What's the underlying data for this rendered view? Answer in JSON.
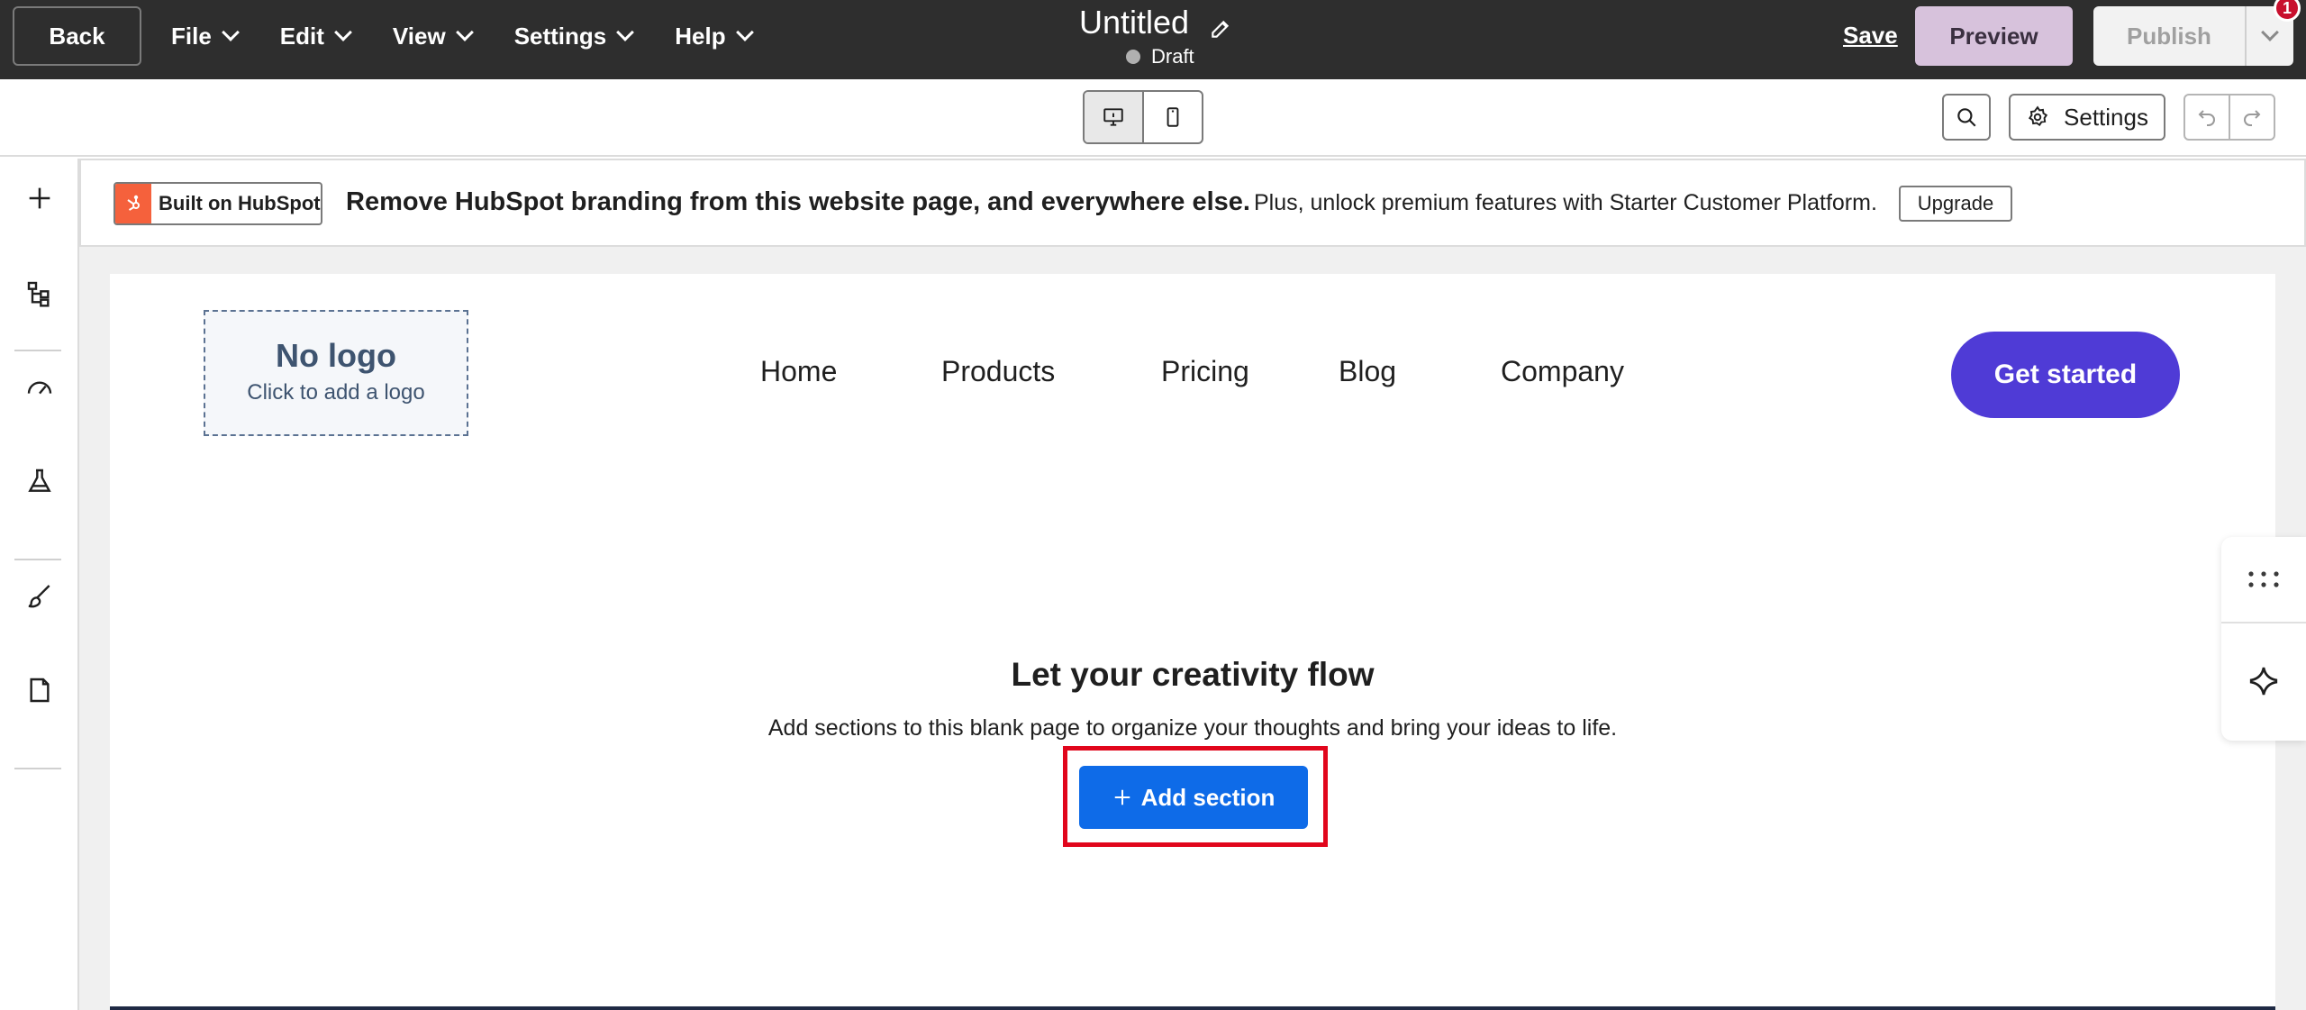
{
  "topbar": {
    "back_label": "Back",
    "menu": [
      {
        "label": "File"
      },
      {
        "label": "Edit"
      },
      {
        "label": "View"
      },
      {
        "label": "Settings"
      },
      {
        "label": "Help"
      }
    ],
    "page_title": "Untitled",
    "status": "Draft",
    "save_label": "Save",
    "preview_label": "Preview",
    "publish_label": "Publish",
    "notification_count": "1"
  },
  "toolbar": {
    "settings_label": "Settings"
  },
  "banner": {
    "badge_label": "Built on HubSpot",
    "headline": "Remove HubSpot branding from this website page, and everywhere else.",
    "text": "Plus, unlock premium features with Starter Customer Platform.",
    "upgrade_label": "Upgrade"
  },
  "page": {
    "logo_title": "No logo",
    "logo_subtitle": "Click to add a logo",
    "nav": [
      {
        "label": "Home"
      },
      {
        "label": "Products"
      },
      {
        "label": "Pricing"
      },
      {
        "label": "Blog"
      },
      {
        "label": "Company"
      }
    ],
    "cta_label": "Get started",
    "empty_title": "Let your creativity flow",
    "empty_subtitle": "Add sections to this blank page to organize your thoughts and bring your ideas to life.",
    "add_section_label": "Add section"
  },
  "colors": {
    "topbar_bg": "#2e2e2e",
    "preview_bg": "#d7c2dc",
    "cta_bg": "#4f3bd6",
    "add_section_bg": "#0e6be8",
    "highlight": "#e1061c",
    "hubspot_orange": "#f5613c"
  }
}
